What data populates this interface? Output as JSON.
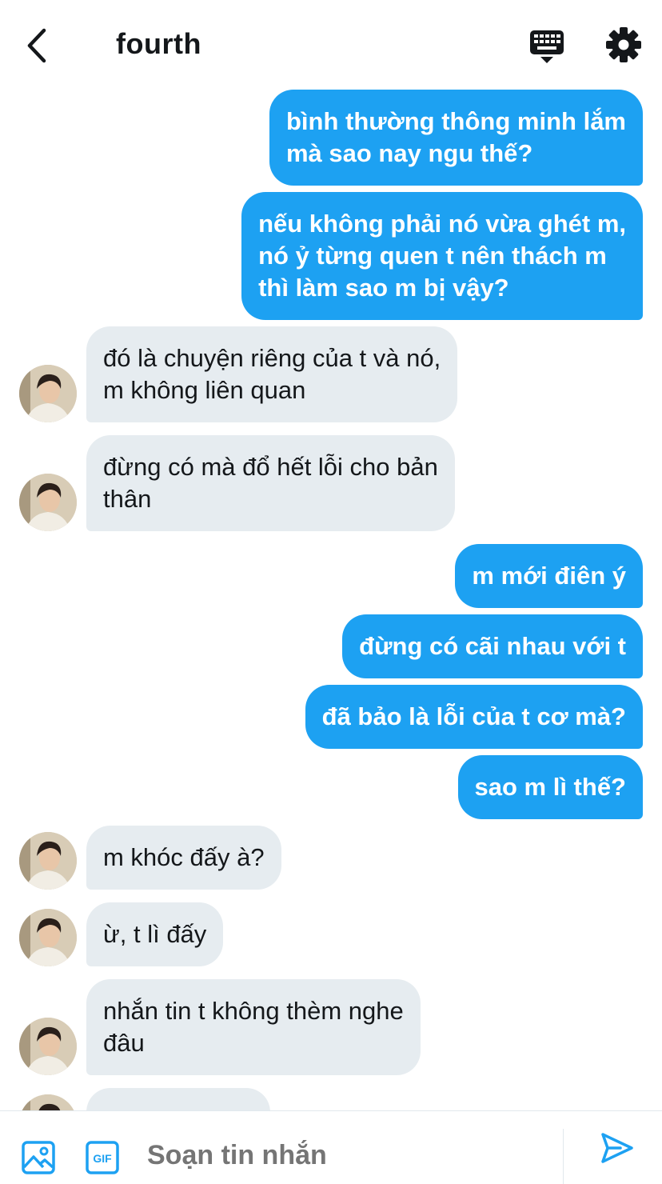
{
  "header": {
    "title": "fourth",
    "back_icon": "chevron-left-icon",
    "keyboard_icon": "keyboard-icon",
    "settings_icon": "gear-icon"
  },
  "messages": [
    {
      "side": "out",
      "text": "bình thường thông minh lắm\nmà sao nay ngu thế?"
    },
    {
      "side": "out",
      "text": "nếu không phải nó vừa ghét m,\nnó ỷ từng quen t nên thách m\nthì làm sao m bị vậy?"
    },
    {
      "side": "in",
      "text": "đó là chuyện riêng của t và nó,\nm không liên quan"
    },
    {
      "side": "in",
      "text": "đừng có mà đổ hết lỗi cho bản\nthân"
    },
    {
      "side": "out",
      "text": "m mới điên ý"
    },
    {
      "side": "out",
      "text": "đừng có cãi nhau với t"
    },
    {
      "side": "out",
      "text": "đã bảo là lỗi của t cơ mà?"
    },
    {
      "side": "out",
      "text": "sao m lì thế?"
    },
    {
      "side": "in",
      "text": "m khóc đấy à?"
    },
    {
      "side": "in",
      "text": "ừ, t lì đấy"
    },
    {
      "side": "in",
      "text": "nhắn tin t không thèm nghe\nđâu"
    },
    {
      "side": "in",
      "text": ""
    }
  ],
  "composer": {
    "placeholder": "Soạn tin nhắn",
    "media_icon": "image-icon",
    "gif_icon": "gif-icon",
    "gif_label": "GIF",
    "send_icon": "send-icon"
  },
  "colors": {
    "accent": "#1da1f2",
    "incoming_bubble": "#e6ecf0",
    "text": "#14171a",
    "placeholder": "#657786"
  }
}
